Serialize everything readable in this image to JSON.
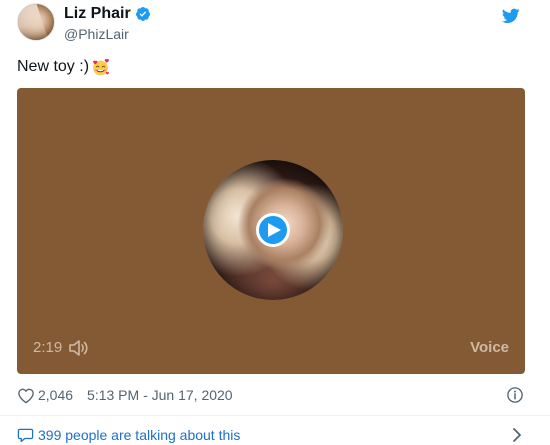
{
  "author": {
    "display_name": "Liz Phair",
    "handle": "@PhizLair",
    "verified": true
  },
  "tweet": {
    "text": "New toy :)",
    "emoji": "smiling-face-with-hearts-icon"
  },
  "media": {
    "type": "voice",
    "duration": "2:19",
    "label": "Voice",
    "background_color": "#845a35"
  },
  "meta": {
    "like_count": "2,046",
    "timestamp": "5:13 PM - Jun 17, 2020"
  },
  "conversation": {
    "label": "399 people are talking about this"
  },
  "colors": {
    "accent": "#1d9bf0",
    "link": "#1d6fcf",
    "secondary_text": "#536471"
  }
}
